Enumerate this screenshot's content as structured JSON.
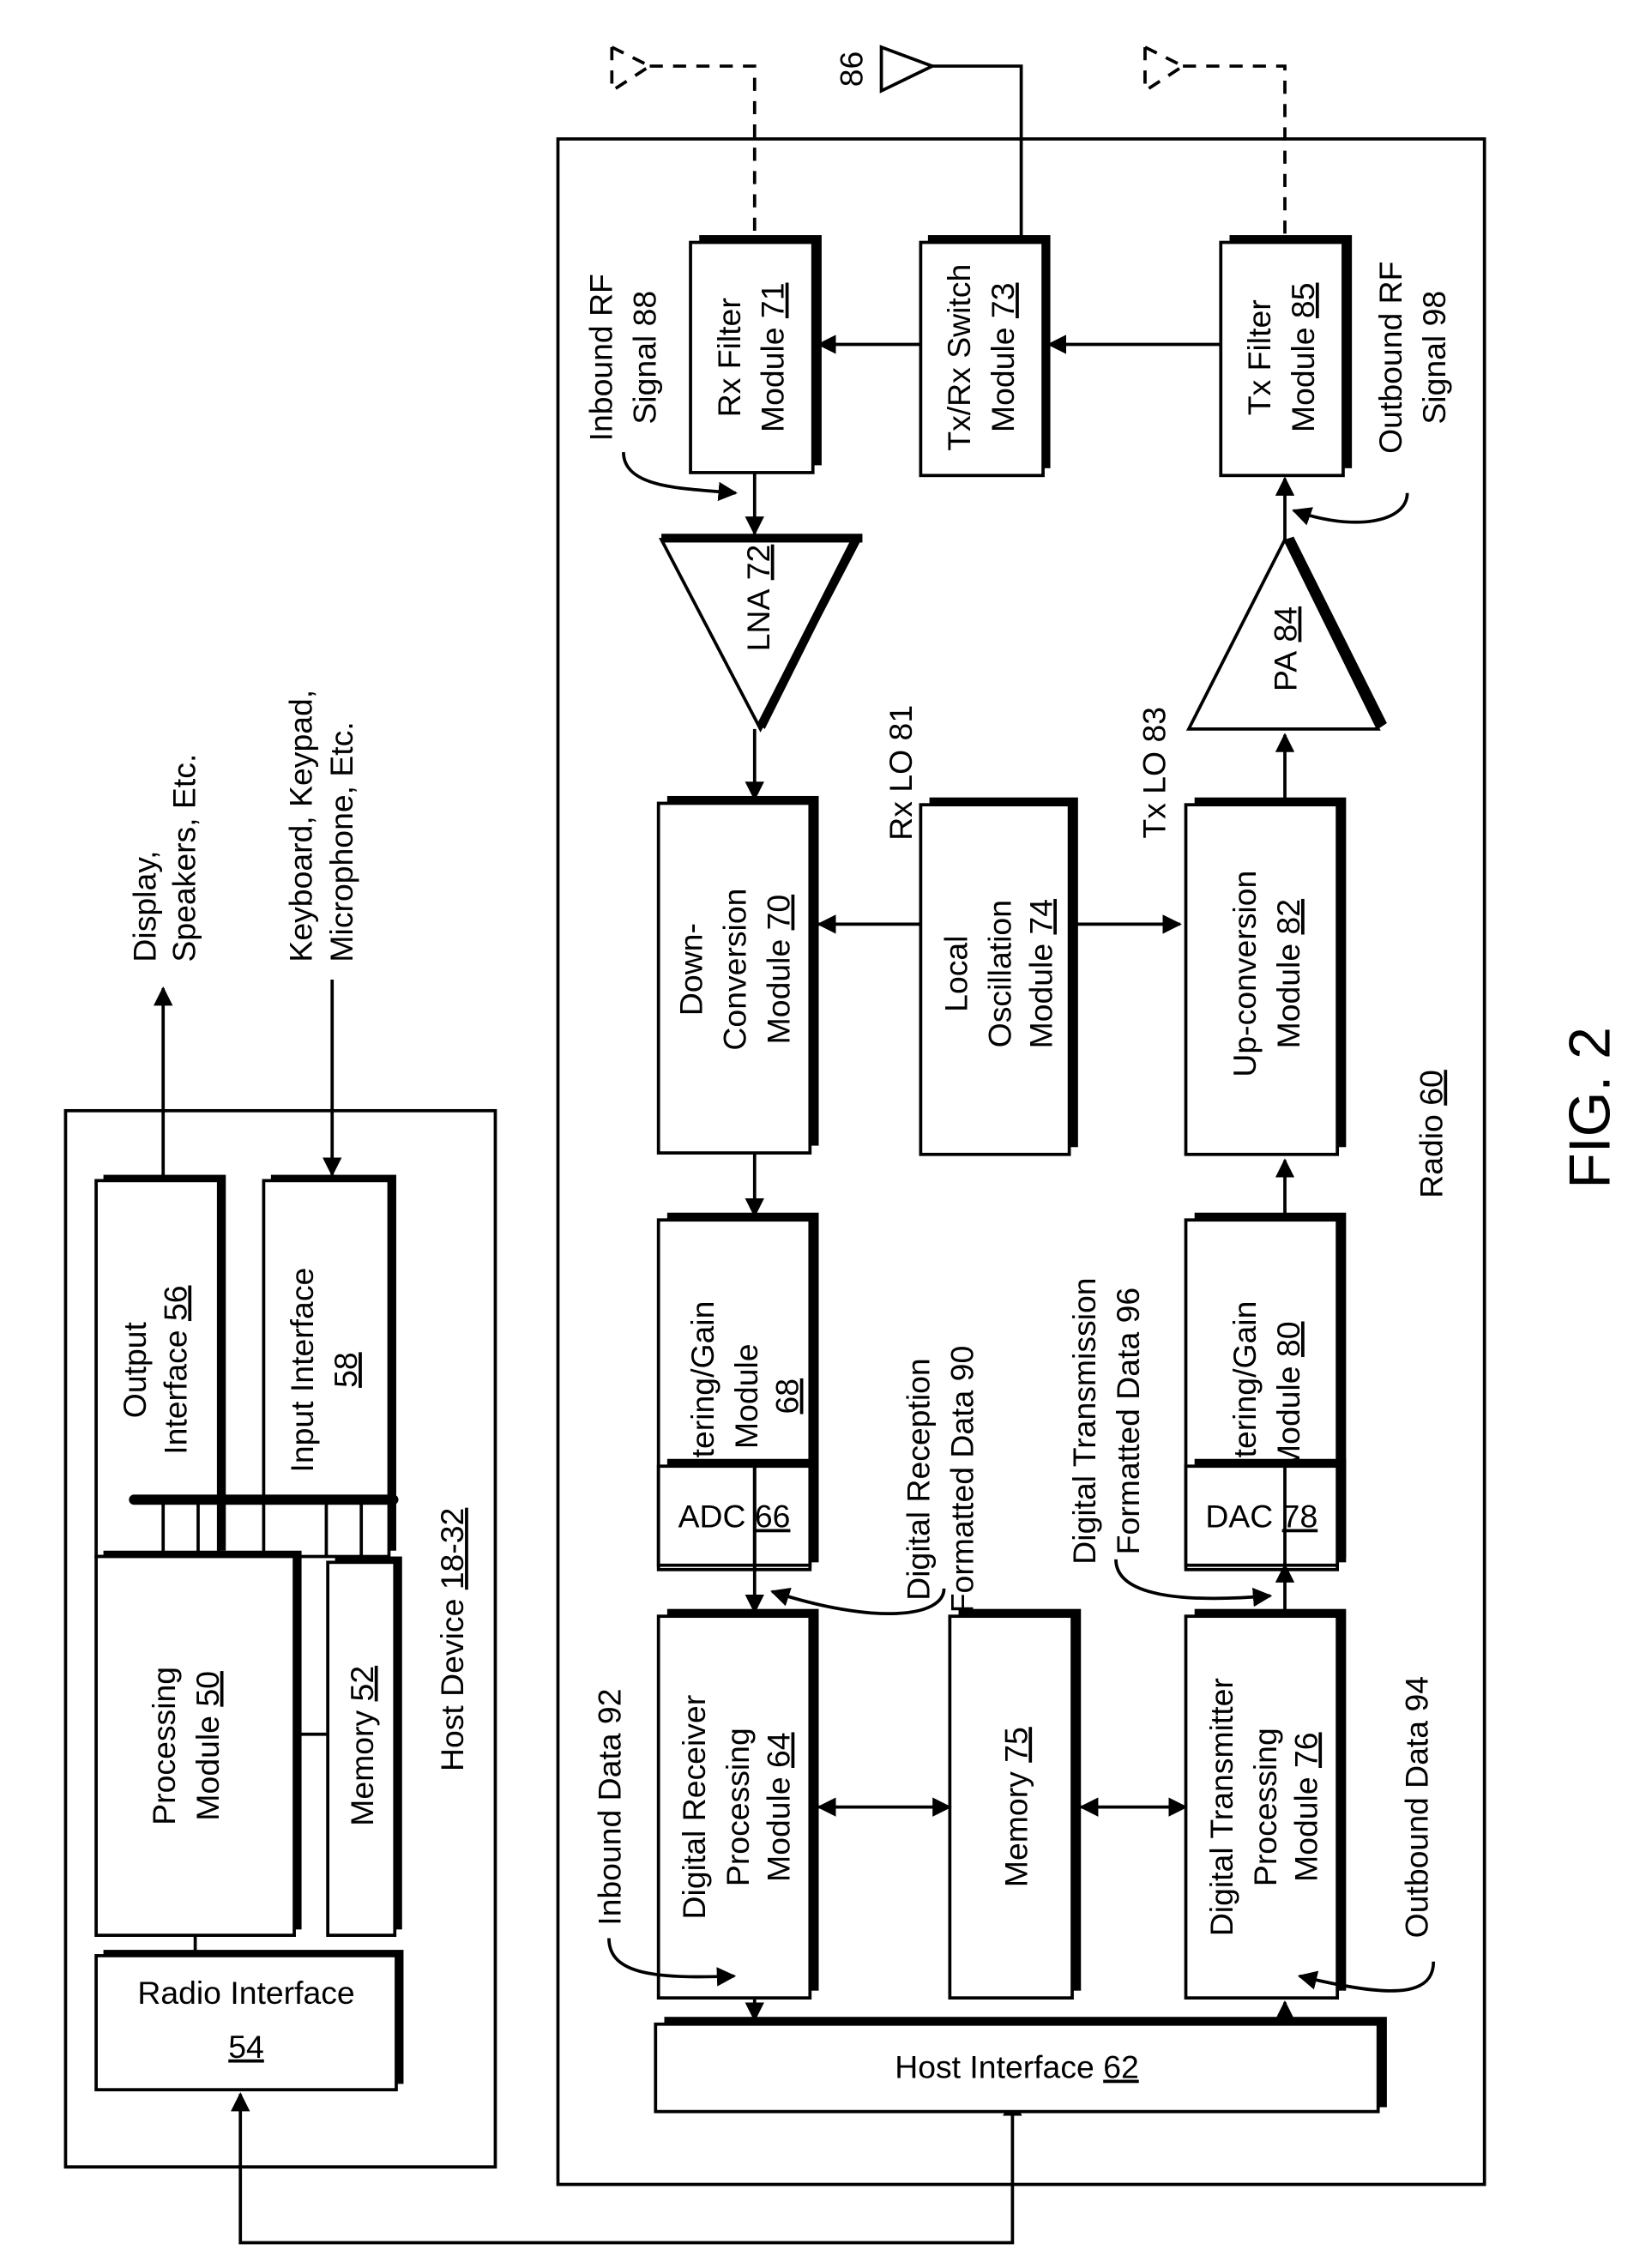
{
  "figure": {
    "label": "FIG. 2"
  },
  "host_device": {
    "title": "Host Device",
    "ref": "18-32",
    "external_output_label": [
      "Display,",
      "Speakers, Etc."
    ],
    "external_input_label": [
      "Keyboard, Keypad,",
      "Microphone, Etc."
    ],
    "blocks": {
      "processing": {
        "lines": [
          "Processing",
          "Module"
        ],
        "ref": "50"
      },
      "memory": {
        "lines": [
          "Memory"
        ],
        "ref": "52"
      },
      "radio_interface": {
        "lines": [
          "Radio Interface"
        ],
        "ref": "54"
      },
      "output_interface": {
        "lines": [
          "Output",
          "Interface"
        ],
        "ref": "56"
      },
      "input_interface": {
        "lines": [
          "Input Interface"
        ],
        "ref": "58"
      }
    }
  },
  "radio": {
    "title": "Radio",
    "ref": "60",
    "antenna_ref": "86",
    "blocks": {
      "host_interface": {
        "text": "Host Interface",
        "ref": "62"
      },
      "digital_rx": {
        "lines": [
          "Digital Receiver",
          "Processing",
          "Module"
        ],
        "ref": "64"
      },
      "adc": {
        "text": "ADC",
        "ref": "66"
      },
      "filter_gain_rx": {
        "lines": [
          "Filtering/Gain",
          "Module"
        ],
        "ref": "68"
      },
      "down_conversion": {
        "lines": [
          "Down-",
          "Conversion",
          "Module"
        ],
        "ref": "70"
      },
      "rx_filter": {
        "lines": [
          "Rx Filter",
          "Module"
        ],
        "ref": "71"
      },
      "lna": {
        "text": "LNA",
        "ref": "72"
      },
      "txrx_switch": {
        "lines": [
          "Tx/Rx Switch",
          "Module"
        ],
        "ref": "73"
      },
      "local_oscillation": {
        "lines": [
          "Local",
          "Oscillation",
          "Module"
        ],
        "ref": "74"
      },
      "memory": {
        "text": "Memory",
        "ref": "75"
      },
      "digital_tx": {
        "lines": [
          "Digital Transmitter",
          "Processing",
          "Module"
        ],
        "ref": "76"
      },
      "dac": {
        "text": "DAC",
        "ref": "78"
      },
      "filter_gain_tx": {
        "lines": [
          "Filtering/Gain",
          "Module"
        ],
        "ref": "80"
      },
      "up_conversion": {
        "lines": [
          "Up-conversion",
          "Module"
        ],
        "ref": "82"
      },
      "pa": {
        "text": "PA",
        "ref": "84"
      },
      "tx_filter": {
        "lines": [
          "Tx Filter",
          "Module"
        ],
        "ref": "85"
      }
    },
    "signals": {
      "rx_lo": "Rx LO 81",
      "tx_lo": "Tx LO 83",
      "inbound_rf": [
        "Inbound RF",
        "Signal 88"
      ],
      "outbound_rf": [
        "Outbound RF",
        "Signal 98"
      ],
      "digital_reception": [
        "Digital Reception",
        "Formatted Data 90"
      ],
      "digital_transmission": [
        "Digital Transmission",
        "Formatted Data 96"
      ],
      "inbound_data": "Inbound Data 92",
      "outbound_data": "Outbound Data 94"
    }
  }
}
